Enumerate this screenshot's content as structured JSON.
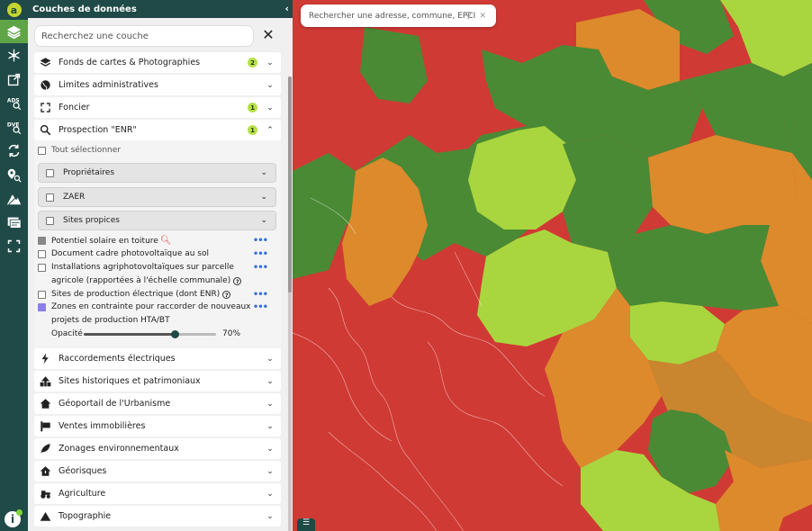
{
  "app": {
    "logo": "a"
  },
  "rail": {
    "items": [
      "layers-icon",
      "snowflake-icon",
      "file-export-icon",
      "ads-icon",
      "dve-icon",
      "arrows-icon",
      "pin-search-icon",
      "terrain-icon",
      "documents-icon",
      "fullscreen-icon"
    ]
  },
  "panel": {
    "title": "Couches de données",
    "search_placeholder": "Recherchez une couche",
    "categories": [
      {
        "label": "Fonds de cartes & Photographies",
        "badge": "2"
      },
      {
        "label": "Limites administratives"
      },
      {
        "label": "Foncier",
        "badge": "1"
      },
      {
        "label": "Prospection \"ENR\"",
        "badge": "1"
      },
      {
        "label": "Raccordements électriques"
      },
      {
        "label": "Sites historiques et patrimoniaux"
      },
      {
        "label": "Géoportail de l'Urbanisme"
      },
      {
        "label": "Ventes immobilières"
      },
      {
        "label": "Zonages environnementaux"
      },
      {
        "label": "Géorisques"
      },
      {
        "label": "Agriculture"
      },
      {
        "label": "Topographie"
      }
    ],
    "prospection": {
      "select_all": "Tout sélectionner",
      "subgroups": [
        "Propriétaires",
        "ZAER",
        "Sites propices"
      ],
      "layers": {
        "solaire": "Potentiel solaire en toiture",
        "doc_cadre": "Document cadre photovoltaïque au sol",
        "agri_1": "Installations agriphotovoltaïques sur parcelle",
        "agri_2": "agricole (rapportées à l'échelle communale)",
        "sites_prod": "Sites de production électrique (dont ENR)",
        "zones_1": "Zones en contrainte pour raccorder de nouveaux",
        "zones_2": "projets de production HTA/BT"
      },
      "opacity_label": "Opacité",
      "opacity_value": "70%",
      "opacity": 0.7
    }
  },
  "map": {
    "search_placeholder": "Rechercher une adresse, commune, EPCI",
    "colors": {
      "red": "#d03a34",
      "dark_green": "#4a8a35",
      "light_green": "#a9d63f",
      "orange": "#dd8a2c",
      "dark_orange": "#c9862e"
    }
  }
}
